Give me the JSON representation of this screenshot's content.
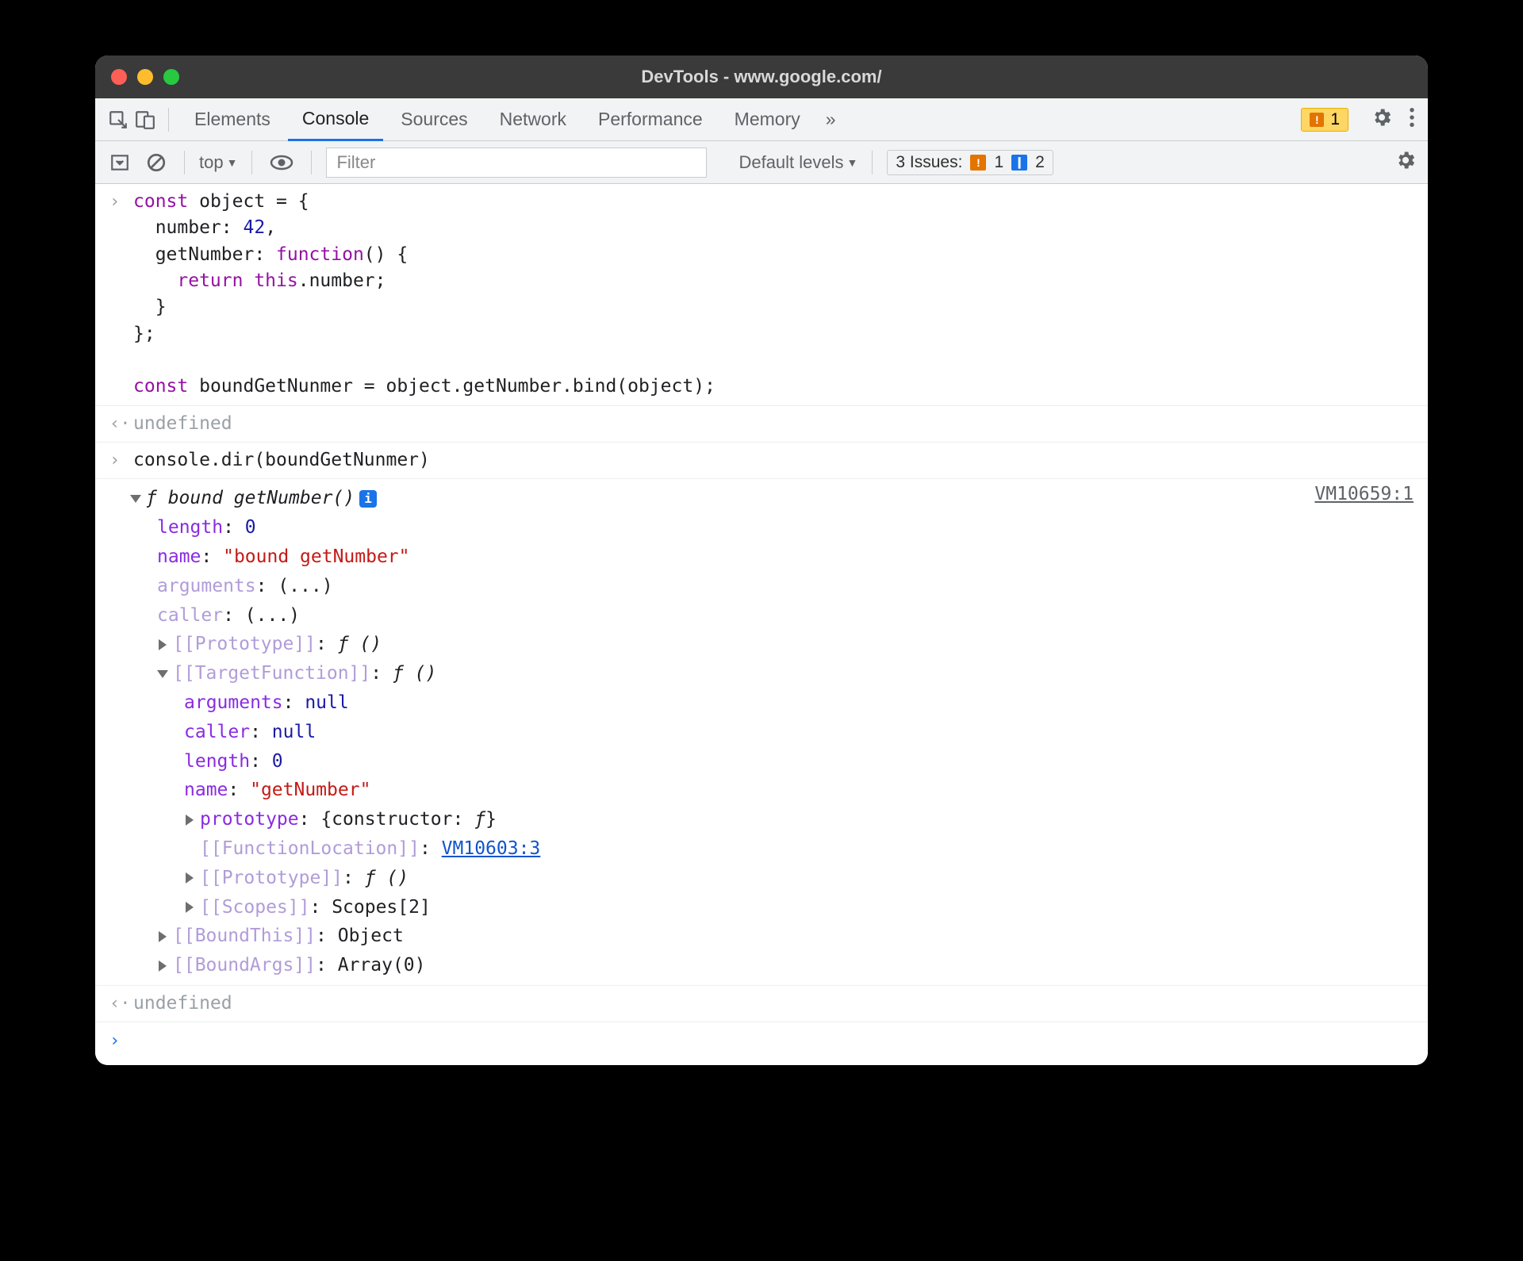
{
  "title": "DevTools - www.google.com/",
  "tabs": {
    "elements": "Elements",
    "console": "Console",
    "sources": "Sources",
    "network": "Network",
    "performance": "Performance",
    "memory": "Memory",
    "more": "»"
  },
  "warn_count": "1",
  "subbar": {
    "context": "top",
    "context_caret": "▼",
    "filter_ph": "Filter",
    "levels": "Default levels",
    "levels_caret": "▼",
    "issues_label": "3 Issues:",
    "issues_warn": "1",
    "issues_info": "2"
  },
  "code": {
    "l1": "const ",
    "l1b": "object = {",
    "l2": "  number: ",
    "l2b": "42",
    "l2c": ",",
    "l3": "  getNumber: ",
    "l3b": "function",
    "l3c": "() {",
    "l4": "    ",
    "l4b": "return this",
    "l4c": ".number;",
    "l5": "  }",
    "l6": "};",
    "blank": "",
    "l7": "const ",
    "l7b": "boundGetNunmer = object.getNumber.bind(object);"
  },
  "out1": "undefined",
  "line2": "console.dir(boundGetNunmer)",
  "dir": {
    "srclink": "VM10659:1",
    "header_f": "ƒ ",
    "header": "bound getNumber()",
    "info": "i",
    "length_k": "length",
    "length_v": "0",
    "name_k": "name",
    "name_v": "\"bound getNumber\"",
    "arguments_k": "arguments",
    "ell": "(...)",
    "caller_k": "caller",
    "proto_k": "[[Prototype]]",
    "proto_v": "ƒ ()",
    "target_k": "[[TargetFunction]]",
    "target_v": "ƒ ()",
    "t_arguments_k": "arguments",
    "t_arguments_v": "null",
    "t_caller_k": "caller",
    "t_caller_v": "null",
    "t_length_k": "length",
    "t_length_v": "0",
    "t_name_k": "name",
    "t_name_v": "\"getNumber\"",
    "t_proto_k": "prototype",
    "t_proto_v": "{constructor: ",
    "t_proto_v2": "ƒ",
    "t_proto_v3": "}",
    "t_funcloc_k": "[[FunctionLocation]]",
    "t_funcloc_v": "VM10603:3",
    "t_proto2_k": "[[Prototype]]",
    "t_proto2_v": "ƒ ()",
    "t_scopes_k": "[[Scopes]]",
    "t_scopes_v": "Scopes[2]",
    "boundthis_k": "[[BoundThis]]",
    "boundthis_v": "Object",
    "boundargs_k": "[[BoundArgs]]",
    "boundargs_v": "Array(0)"
  },
  "out2": "undefined"
}
